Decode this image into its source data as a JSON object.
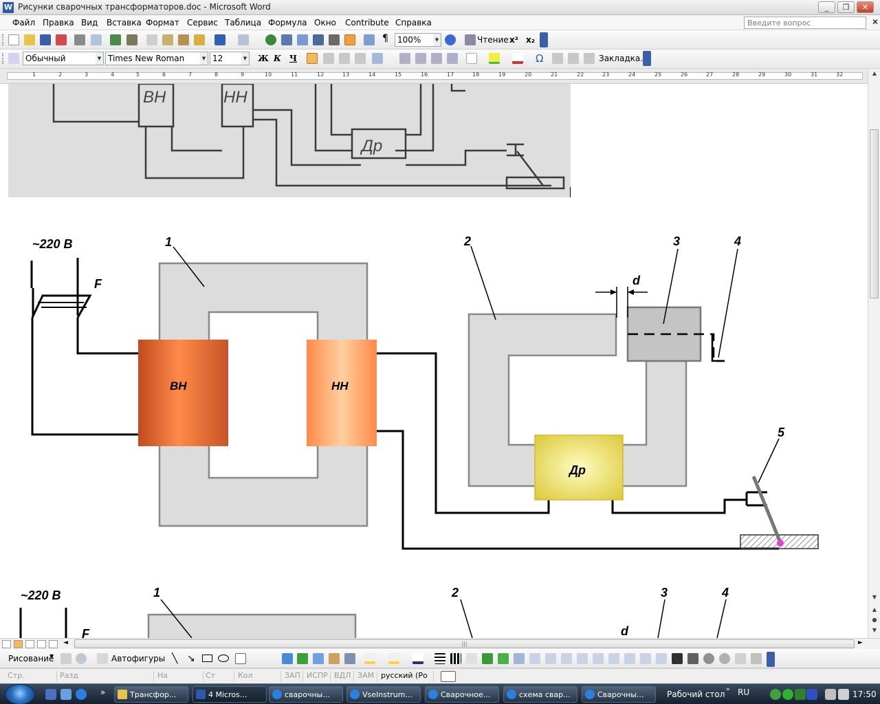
{
  "window": {
    "title": "Рисунки сварочных трансформаторов.doc - Microsoft Word"
  },
  "menu": {
    "items": [
      "Файл",
      "Правка",
      "Вид",
      "Вставка",
      "Формат",
      "Сервис",
      "Таблица",
      "Формула",
      "Окно",
      "Contribute",
      "Справка"
    ],
    "help_placeholder": "Введите вопрос"
  },
  "toolbar": {
    "zoom": "100%",
    "reading_label": "Чтение",
    "superscript": "x²",
    "subscript": "x₂"
  },
  "format_bar": {
    "style": "Обычный",
    "font": "Times New Roman",
    "size": "12",
    "bold": "Ж",
    "italic": "К",
    "underline": "Ч",
    "omega": "Ω",
    "bookmark": "Закладка..."
  },
  "ruler": {
    "marks": [
      "1",
      "2",
      "3",
      "4",
      "5",
      "6",
      "7",
      "8",
      "9",
      "10",
      "11",
      "12",
      "13",
      "14",
      "15",
      "16",
      "17",
      "18",
      "19",
      "20",
      "21",
      "22",
      "23",
      "24",
      "25",
      "26",
      "27",
      "28",
      "29",
      "30",
      "31",
      "32"
    ]
  },
  "figure_top": {
    "labels": {
      "vn": "ВН",
      "nn": "НН",
      "dr": "Др"
    }
  },
  "figure_main": {
    "supply": "~220 В",
    "fuse": "F",
    "numbers": [
      "1",
      "2",
      "3",
      "4",
      "5"
    ],
    "gap": "d",
    "labels": {
      "vn": "ВН",
      "nn": "НН",
      "dr": "Др"
    }
  },
  "figure_bottom": {
    "supply": "~220 В",
    "fuse": "F",
    "numbers": [
      "1",
      "2",
      "3",
      "4"
    ],
    "gap": "d"
  },
  "drawing_bar": {
    "menu": "Рисование",
    "autoshapes": "Автофигуры"
  },
  "status": {
    "page": "Стр.",
    "section": "Разд",
    "at": "На",
    "line": "Ст",
    "col": "Кол",
    "rec": "ЗАП",
    "trk": "ИСПР",
    "ext": "ВДЛ",
    "ovr": "ЗАМ",
    "language": "русский (Ро"
  },
  "taskbar": {
    "tasks": [
      "Трансфор...",
      "4 Micros...",
      "сварочны...",
      "VseInstrum...",
      "Сварочное...",
      "схема свар...",
      "Сварочны..."
    ],
    "desktop": "Рабочий стол",
    "lang": "RU",
    "time": "17:50"
  },
  "colors": {
    "vn_coil": "#d8683a",
    "nn_coil": "#ffb27a",
    "choke": "#e6d44a",
    "core": "#dcdcdc",
    "weld_spark": "#e040e0"
  }
}
